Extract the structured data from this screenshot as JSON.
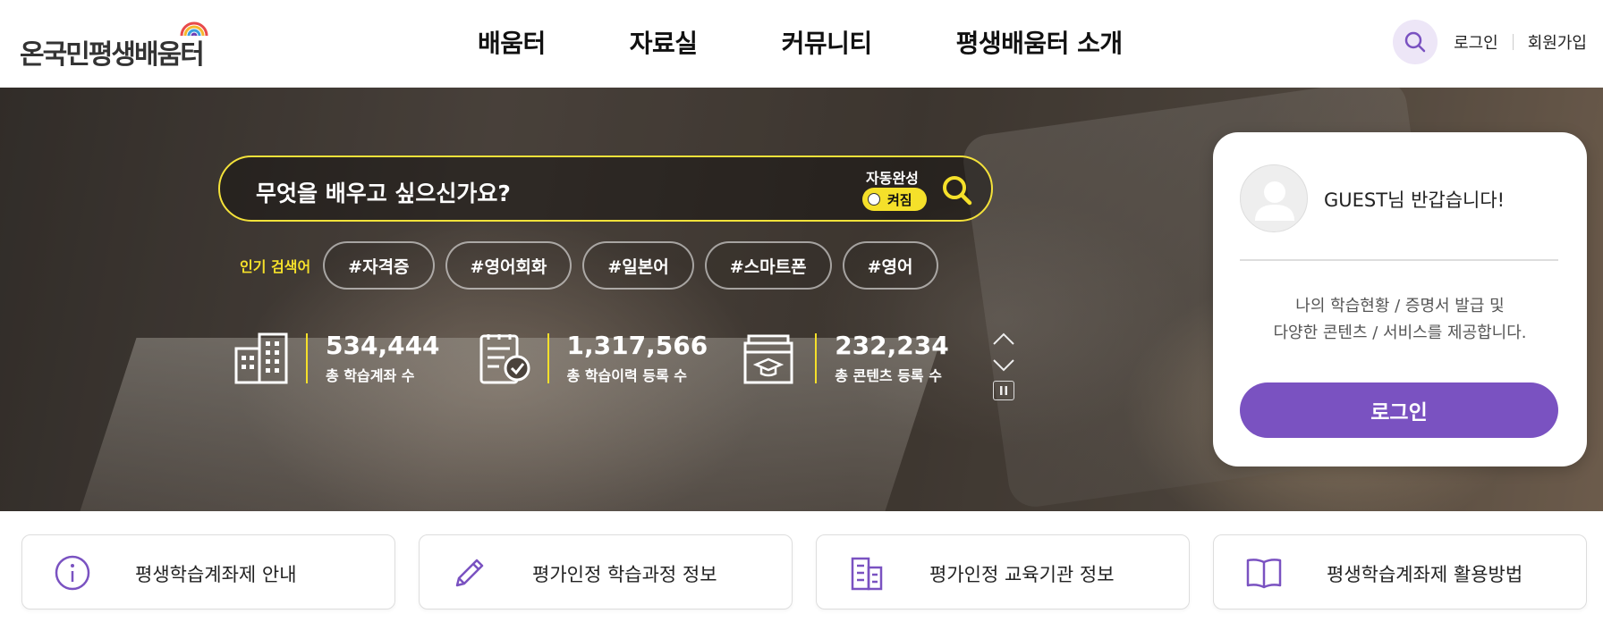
{
  "header": {
    "logo_text": "온국민평생배움터",
    "nav": [
      "배움터",
      "자료실",
      "커뮤니티",
      "평생배움터 소개"
    ],
    "login": "로그인",
    "signup": "회원가입"
  },
  "hero": {
    "search_placeholder": "무엇을 배우고 싶으신가요?",
    "autocomplete_label": "자동완성",
    "autocomplete_state": "켜짐",
    "popular_label": "인기 검색어",
    "popular_tags": [
      "#자격증",
      "#영어회화",
      "#일본어",
      "#스마트폰",
      "#영어"
    ],
    "stats": [
      {
        "value": "534,444",
        "label": "총 학습계좌 수",
        "icon": "building-icon"
      },
      {
        "value": "1,317,566",
        "label": "총 학습이력 등록 수",
        "icon": "checklist-icon"
      },
      {
        "value": "232,234",
        "label": "총 콘텐츠 등록 수",
        "icon": "content-box-icon"
      }
    ]
  },
  "login_card": {
    "greeting": "GUEST님 반갑습니다!",
    "desc_line1": "나의 학습현황 / 증명서 발급 및",
    "desc_line2": "다양한 콘텐츠 / 서비스를 제공합니다.",
    "login_button": "로그인"
  },
  "quick_links": [
    {
      "label": "평생학습계좌제 안내",
      "icon": "info-icon"
    },
    {
      "label": "평가인정 학습과정 정보",
      "icon": "pencil-icon"
    },
    {
      "label": "평가인정 교육기관 정보",
      "icon": "building-icon"
    },
    {
      "label": "평생학습계좌제 활용방법",
      "icon": "book-icon"
    }
  ],
  "colors": {
    "accent": "#7a52c1",
    "highlight": "#f5e02a"
  }
}
